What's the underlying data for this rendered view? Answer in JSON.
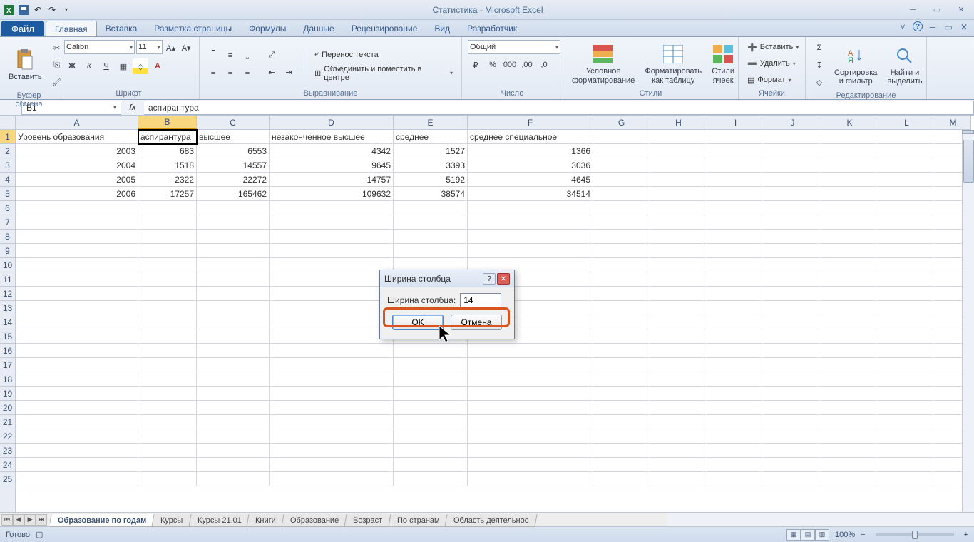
{
  "titlebar": {
    "app_title": "Статистика - Microsoft Excel"
  },
  "ribbon_tabs": {
    "file": "Файл",
    "tabs": [
      "Главная",
      "Вставка",
      "Разметка страницы",
      "Формулы",
      "Данные",
      "Рецензирование",
      "Вид",
      "Разработчик"
    ],
    "active_index": 0
  },
  "ribbon": {
    "clipboard": {
      "paste": "Вставить",
      "title": "Буфер обмена"
    },
    "font": {
      "font_name": "Calibri",
      "font_size": "11",
      "title": "Шрифт"
    },
    "alignment": {
      "wrap": "Перенос текста",
      "merge": "Объединить и поместить в центре",
      "title": "Выравнивание"
    },
    "number": {
      "format": "Общий",
      "title": "Число"
    },
    "styles": {
      "cond": "Условное форматирование",
      "table": "Форматировать как таблицу",
      "cell": "Стили ячеек",
      "title": "Стили"
    },
    "cells": {
      "insert": "Вставить",
      "delete": "Удалить",
      "format": "Формат",
      "title": "Ячейки"
    },
    "editing": {
      "sort": "Сортировка и фильтр",
      "find": "Найти и выделить",
      "title": "Редактирование"
    }
  },
  "formula_bar": {
    "name": "B1",
    "formula": "аспирантура"
  },
  "columns": [
    {
      "id": "A",
      "w": 172
    },
    {
      "id": "B",
      "w": 82
    },
    {
      "id": "C",
      "w": 102
    },
    {
      "id": "D",
      "w": 174
    },
    {
      "id": "E",
      "w": 104
    },
    {
      "id": "F",
      "w": 176
    },
    {
      "id": "G",
      "w": 80
    },
    {
      "id": "H",
      "w": 80
    },
    {
      "id": "I",
      "w": 80
    },
    {
      "id": "J",
      "w": 80
    },
    {
      "id": "K",
      "w": 80
    },
    {
      "id": "L",
      "w": 80
    },
    {
      "id": "M",
      "w": 50
    }
  ],
  "selected_col_index": 1,
  "table": {
    "rows": [
      {
        "num": 1,
        "cells": [
          {
            "v": "Уровень образования",
            "t": "s"
          },
          {
            "v": "аспирантура",
            "t": "s"
          },
          {
            "v": "высшее",
            "t": "s"
          },
          {
            "v": "незаконченное высшее",
            "t": "s"
          },
          {
            "v": "среднее",
            "t": "s"
          },
          {
            "v": "среднее специальное",
            "t": "s"
          }
        ]
      },
      {
        "num": 2,
        "cells": [
          {
            "v": "2003",
            "t": "n"
          },
          {
            "v": "683",
            "t": "n"
          },
          {
            "v": "6553",
            "t": "n"
          },
          {
            "v": "4342",
            "t": "n"
          },
          {
            "v": "1527",
            "t": "n"
          },
          {
            "v": "1366",
            "t": "n"
          }
        ]
      },
      {
        "num": 3,
        "cells": [
          {
            "v": "2004",
            "t": "n"
          },
          {
            "v": "1518",
            "t": "n"
          },
          {
            "v": "14557",
            "t": "n"
          },
          {
            "v": "9645",
            "t": "n"
          },
          {
            "v": "3393",
            "t": "n"
          },
          {
            "v": "3036",
            "t": "n"
          }
        ]
      },
      {
        "num": 4,
        "cells": [
          {
            "v": "2005",
            "t": "n"
          },
          {
            "v": "2322",
            "t": "n"
          },
          {
            "v": "22272",
            "t": "n"
          },
          {
            "v": "14757",
            "t": "n"
          },
          {
            "v": "5192",
            "t": "n"
          },
          {
            "v": "4645",
            "t": "n"
          }
        ]
      },
      {
        "num": 5,
        "cells": [
          {
            "v": "2006",
            "t": "n"
          },
          {
            "v": "17257",
            "t": "n"
          },
          {
            "v": "165462",
            "t": "n"
          },
          {
            "v": "109632",
            "t": "n"
          },
          {
            "v": "38574",
            "t": "n"
          },
          {
            "v": "34514",
            "t": "n"
          }
        ]
      }
    ],
    "empty_rows": 20,
    "total_rows_shown": 25
  },
  "sheet_tabs": {
    "tabs": [
      "Образование по годам",
      "Курсы",
      "Курсы 21.01",
      "Книги",
      "Образование",
      "Возраст",
      "По странам",
      "Область деятельнос"
    ],
    "active_index": 0
  },
  "status_bar": {
    "ready": "Готово",
    "zoom": "100%"
  },
  "dialog": {
    "title": "Ширина столбца",
    "label": "Ширина столбца:",
    "value": "14",
    "ok": "OK",
    "cancel": "Отмена"
  }
}
